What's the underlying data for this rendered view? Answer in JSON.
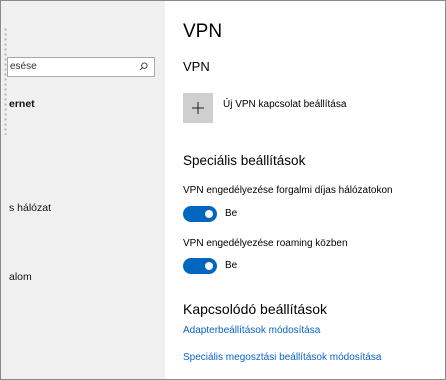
{
  "nav": {
    "search": {
      "value": "esése"
    },
    "items": [
      {
        "label": "ernet",
        "bold": true
      },
      {
        "label": "s hálózat",
        "bold": false
      },
      {
        "label": "alom",
        "bold": false
      }
    ]
  },
  "page": {
    "title": "VPN"
  },
  "vpn_section": {
    "heading": "VPN",
    "add_label": "Új VPN kapcsolat beállítása"
  },
  "advanced": {
    "heading": "Speciális beállítások",
    "metered": {
      "label": "VPN engedélyezése forgalmi díjas hálózatokon",
      "state": "Be",
      "on": true
    },
    "roaming": {
      "label": "VPN engedélyezése roaming közben",
      "state": "Be",
      "on": true
    }
  },
  "related": {
    "heading": "Kapcsolódó beállítások",
    "links": [
      "Adapterbeállítások módosítása",
      "Speciális megosztási beállítások módosítása"
    ]
  },
  "colors": {
    "accent": "#0067c0",
    "link": "#0a63c9",
    "nav_bg": "#f0f0f0"
  }
}
